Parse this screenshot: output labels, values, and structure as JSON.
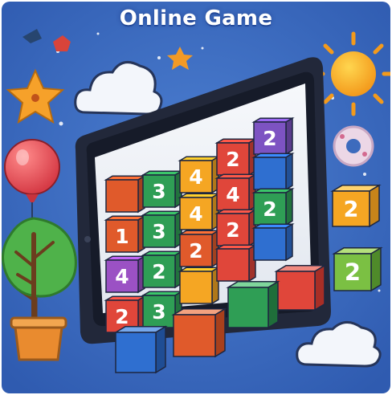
{
  "header": {
    "title": "Online Game"
  },
  "colors": {
    "background": "#3f6fc2",
    "background_edge": "#2b55a8",
    "tablet_frame": "#22283a",
    "tablet_screen": "#eef1f6",
    "sun": "#f6b92d",
    "cloud": "#f2f6fb",
    "balloon": "#e8525a",
    "tree": "#4fb24a",
    "pot": "#e98b2f",
    "star": "#f5a623"
  },
  "board": {
    "rows": [
      [
        {
          "label": "",
          "color": "#e05a2b"
        },
        {
          "label": "3",
          "color": "#2f9e55"
        },
        {
          "label": "4",
          "color": "#f5a623"
        },
        {
          "label": "2",
          "color": "#e0463a"
        },
        {
          "label": "2",
          "color": "#7d53c2"
        }
      ],
      [
        {
          "label": "1",
          "color": "#e05a2b"
        },
        {
          "label": "3",
          "color": "#2f9e55"
        },
        {
          "label": "4",
          "color": "#f5a623"
        },
        {
          "label": "4",
          "color": "#e0463a"
        },
        {
          "label": "",
          "color": "#2f6fd0"
        }
      ],
      [
        {
          "label": "4",
          "color": "#9b51c4"
        },
        {
          "label": "2",
          "color": "#2f9e55"
        },
        {
          "label": "2",
          "color": "#e05a2b"
        },
        {
          "label": "2",
          "color": "#e0463a"
        },
        {
          "label": "2",
          "color": "#2f9e55"
        }
      ],
      [
        {
          "label": "2",
          "color": "#e0463a"
        },
        {
          "label": "3",
          "color": "#2f9e55"
        },
        {
          "label": "",
          "color": "#f5a623"
        },
        {
          "label": "",
          "color": "#e0463a"
        },
        {
          "label": "",
          "color": "#2f6fd0"
        }
      ]
    ]
  },
  "floating_blocks": [
    {
      "label": "2",
      "front": "#f5a623",
      "side": "#c7841a",
      "top": "#ffd36e"
    },
    {
      "label": "2",
      "front": "#7bc043",
      "side": "#4f8a2a",
      "top": "#b5e07c"
    },
    {
      "label": "",
      "front": "#e0463a",
      "side": "#a82e26",
      "top": "#f08a80"
    },
    {
      "label": "",
      "front": "#2f9e55",
      "side": "#1f6e3a",
      "top": "#7fd59b"
    },
    {
      "label": "",
      "front": "#e05a2b",
      "side": "#a8401c",
      "top": "#f3a27f"
    },
    {
      "label": "",
      "front": "#2f6fd0",
      "side": "#1f4d94",
      "top": "#76a8ec"
    }
  ]
}
